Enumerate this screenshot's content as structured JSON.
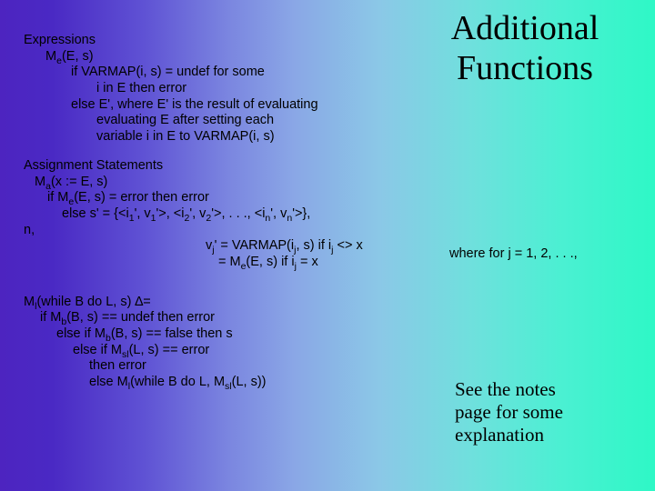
{
  "title_line1": "Additional",
  "title_line2": "Functions",
  "exp": {
    "h": "Expressions",
    "me": "(E, s)",
    "l1": "if VARMAP(i, s) = undef for some",
    "l2": "i in E then error",
    "l3": "else E', where E' is the result of evaluating",
    "l4": "evaluating E after setting each",
    "l5": "variable i in E to VARMAP(i, s)"
  },
  "asg": {
    "h": "Assignment Statements",
    "ma": "(x := E, s)",
    "l1_a": "if M",
    "l1_b": "(E, s) = error then error",
    "l2_a": "else s' = {<i",
    "l2_b": "', v",
    "l2_c": "'>, <i",
    "l2_d": "', v",
    "l2_e": "'>, . . ., <i",
    "l2_f": "', v",
    "l2_g": "'>},",
    "nline": "n,",
    "l3_a": "v",
    "l3_b": "' = VARMAP(i",
    "l3_c": ", s) if i",
    "l3_d": " <> x",
    "l4_a": "= M",
    "l4_b": "(E, s) if i",
    "l4_c": " = x"
  },
  "wherefor": "where for j = 1, 2, . . ., ",
  "whi": {
    "l1_a": "M",
    "l1_b": "(while B do L, s) ∆=",
    "l2_a": "if M",
    "l2_b": "(B, s) == undef then error",
    "l3_a": "else if M",
    "l3_b": "(B, s) == false then s",
    "l4_a": "else if M",
    "l4_b": "(L, s) == error",
    "l5": "then error",
    "l6_a": "else M",
    "l6_b": "(while B do L, M",
    "l6_c": "(L, s))"
  },
  "note_line1": "See the notes",
  "note_line2": "page for some",
  "note_line3": "explanation"
}
